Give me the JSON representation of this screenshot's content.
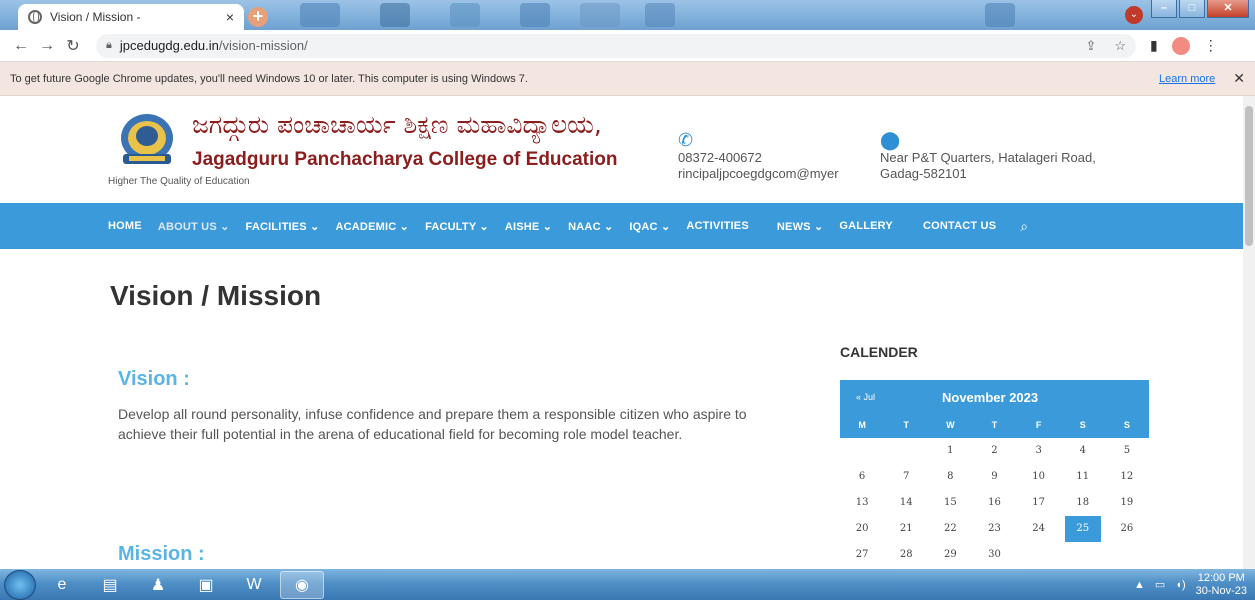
{
  "browser": {
    "tab_title": "Vision / Mission -",
    "tab_close": "×",
    "new_tab": "+",
    "url_domain": "jpcedugdg.edu.in",
    "url_path": "/vision-mission/",
    "info_message": "To get future Google Chrome updates, you'll need Windows 10 or later. This computer is using Windows 7.",
    "info_learn_more": "Learn more",
    "info_close": "✕"
  },
  "header": {
    "kannada_name": "ಜಗದ್ಗುರು ಪಂಚಾಚಾರ್ಯ ಶಿಕ್ಷಣ ಮಹಾವಿದ್ಯಾಲಯ,",
    "college_name": "Jagadguru Panchacharya College of Education",
    "tagline": "Higher The Quality of Education",
    "phone": "08372-400672",
    "email": "rincipaljpcoegdgcom@myer",
    "address_line1": "Near P&T Quarters, Hatalageri Road,",
    "address_line2": "Gadag-582101"
  },
  "nav": {
    "items": [
      {
        "label": "HOME"
      },
      {
        "label": "ABOUT US ⌄"
      },
      {
        "label": "FACILITIES ⌄"
      },
      {
        "label": "ACADEMIC ⌄"
      },
      {
        "label": "FACULTY ⌄"
      },
      {
        "label": "AISHE ⌄"
      },
      {
        "label": "NAAC ⌄"
      },
      {
        "label": "IQAC ⌄"
      },
      {
        "label": "ACTIVITIES"
      },
      {
        "label": "NEWS ⌄"
      },
      {
        "label": "GALLERY"
      },
      {
        "label": "CONTACT US"
      }
    ]
  },
  "main": {
    "title": "Vision / Mission",
    "vision_heading": "Vision :",
    "vision_text": "Develop all round personality, infuse confidence and prepare them a responsible citizen who aspire to achieve their full potential in the arena of educational field for becoming role model teacher.",
    "mission_heading": "Mission :"
  },
  "calendar": {
    "heading": "CALENDER",
    "prev": "« Jul",
    "month": "November 2023",
    "days": [
      "M",
      "T",
      "W",
      "T",
      "F",
      "S",
      "S"
    ],
    "cells": [
      "",
      "",
      "1",
      "2",
      "3",
      "4",
      "5",
      "6",
      "7",
      "8",
      "9",
      "10",
      "11",
      "12",
      "13",
      "14",
      "15",
      "16",
      "17",
      "18",
      "19",
      "20",
      "21",
      "22",
      "23",
      "24",
      "25",
      "26",
      "27",
      "28",
      "29",
      "30",
      "",
      "",
      ""
    ],
    "today": "25"
  },
  "taskbar": {
    "time": "12:00 PM",
    "date": "30-Nov-23"
  }
}
